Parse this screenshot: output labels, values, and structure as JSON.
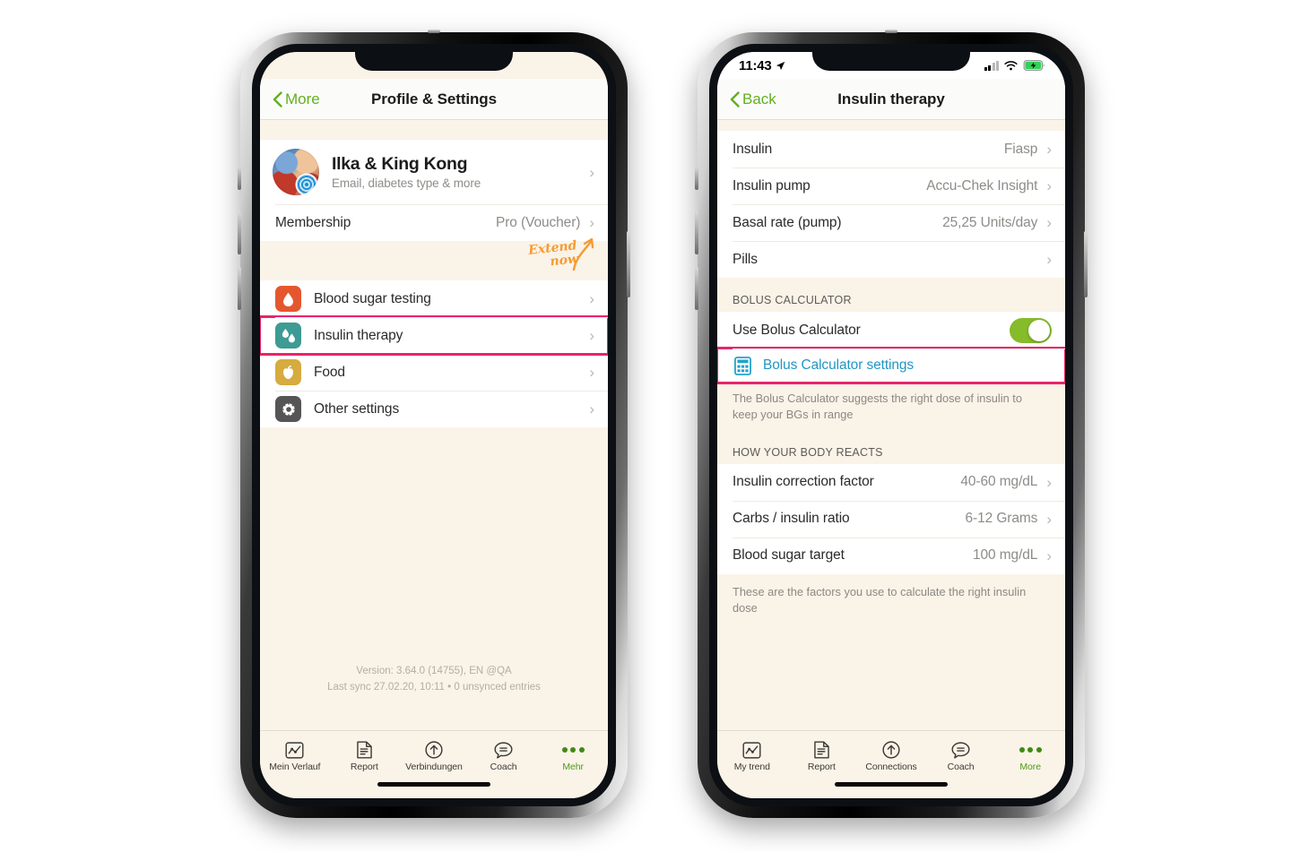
{
  "left_phone": {
    "status_bar": {
      "visible": false
    },
    "nav": {
      "back_label": "More",
      "title": "Profile & Settings"
    },
    "profile": {
      "name": "Ilka  & King Kong",
      "subtitle": "Email, diabetes type & more"
    },
    "membership": {
      "label": "Membership",
      "value": "Pro (Voucher)"
    },
    "annotation": {
      "line1": "Extend",
      "line2": "now",
      "color": "#f59b32"
    },
    "menu_items": [
      {
        "label": "Blood sugar testing",
        "icon": "blood-drop-icon",
        "color": "#e4572e",
        "highlighted": false
      },
      {
        "label": "Insulin therapy",
        "icon": "insulin-drops-icon",
        "color": "#3d9b93",
        "highlighted": true
      },
      {
        "label": "Food",
        "icon": "apple-icon",
        "color": "#d6ab3f",
        "highlighted": false
      },
      {
        "label": "Other settings",
        "icon": "gear-icon",
        "color": "#555555",
        "highlighted": false
      }
    ],
    "version": {
      "line1": "Version: 3.64.0 (14755), EN @QA",
      "line2": "Last sync 27.02.20, 10:11 • 0 unsynced entries"
    },
    "tabs": [
      {
        "label": "Mein Verlauf",
        "icon": "trend-chart-icon",
        "active": false
      },
      {
        "label": "Report",
        "icon": "document-icon",
        "active": false
      },
      {
        "label": "Verbindungen",
        "icon": "arrow-up-circle-icon",
        "active": false
      },
      {
        "label": "Coach",
        "icon": "speech-bubble-icon",
        "active": false
      },
      {
        "label": "Mehr",
        "icon": "more-dots-icon",
        "active": true
      }
    ]
  },
  "right_phone": {
    "status_bar": {
      "visible": true,
      "time": "11:43",
      "location_icon": "location-arrow-icon",
      "signal_icon": "cellular-bars-icon",
      "wifi_icon": "wifi-icon",
      "battery_icon": "battery-charging-icon"
    },
    "nav": {
      "back_label": "Back",
      "title": "Insulin therapy"
    },
    "therapy_rows": [
      {
        "label": "Insulin",
        "value": "Fiasp"
      },
      {
        "label": "Insulin pump",
        "value": "Accu-Chek Insight"
      },
      {
        "label": "Basal rate (pump)",
        "value": "25,25 Units/day"
      },
      {
        "label": "Pills",
        "value": ""
      }
    ],
    "bolus_section": {
      "header": "BOLUS CALCULATOR",
      "toggle_label": "Use Bolus Calculator",
      "toggle_on": true,
      "toggle_color": "#86bb2a",
      "settings_label": "Bolus Calculator settings",
      "settings_icon": "calculator-icon",
      "settings_color": "#2196c4",
      "settings_highlighted": true,
      "footer": "The Bolus Calculator suggests the right dose of insulin to keep your BGs in range"
    },
    "body_section": {
      "header": "HOW YOUR BODY REACTS",
      "rows": [
        {
          "label": "Insulin correction factor",
          "value": "40-60 mg/dL"
        },
        {
          "label": "Carbs / insulin ratio",
          "value": "6-12 Grams"
        },
        {
          "label": "Blood sugar target",
          "value": "100 mg/dL"
        }
      ],
      "footer": "These are the factors you use to calculate the right insulin dose"
    },
    "tabs": [
      {
        "label": "My trend",
        "icon": "trend-chart-icon",
        "active": false
      },
      {
        "label": "Report",
        "icon": "document-icon",
        "active": false
      },
      {
        "label": "Connections",
        "icon": "arrow-up-circle-icon",
        "active": false
      },
      {
        "label": "Coach",
        "icon": "speech-bubble-icon",
        "active": false
      },
      {
        "label": "More",
        "icon": "more-dots-icon",
        "active": true
      }
    ]
  },
  "theme": {
    "highlight_pink": "#e8246c",
    "accent_green": "#63b021",
    "background_cream": "#faf3e8"
  }
}
